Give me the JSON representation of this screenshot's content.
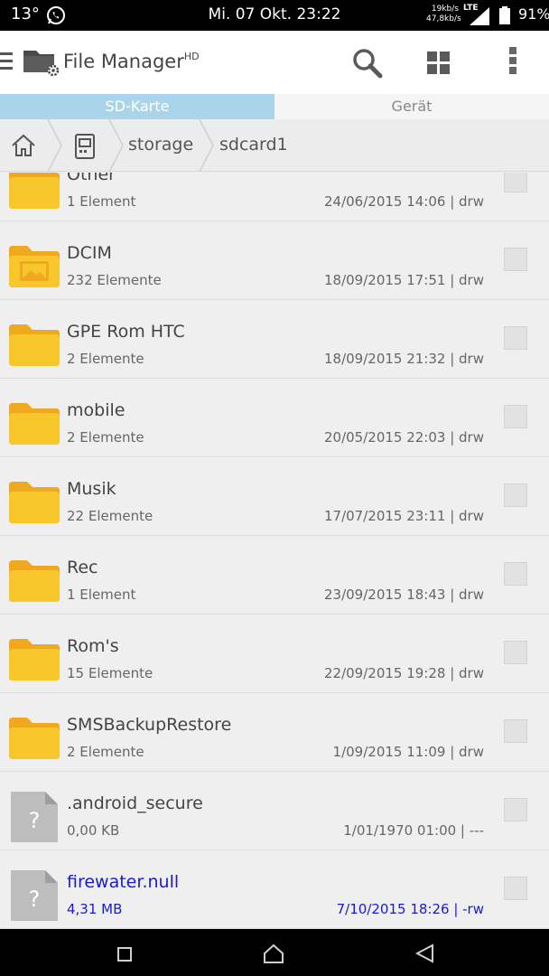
{
  "status_bar": {
    "temperature": "13°",
    "clock": "Mi. 07 Okt. 23:22",
    "speed_up": "19kb/s",
    "speed_down": "47,8kb/s",
    "network": "LTE",
    "battery": "91%"
  },
  "app_bar": {
    "title": "File Manager",
    "title_suffix": "HD"
  },
  "tabs": [
    {
      "label": "SD-Karte",
      "active": true
    },
    {
      "label": "Gerät",
      "active": false
    }
  ],
  "breadcrumb": [
    "storage",
    "sdcard1"
  ],
  "files": [
    {
      "name": "Other",
      "count": "1 Element",
      "meta": "24/06/2015 14:06 | drw",
      "type": "folder"
    },
    {
      "name": "DCIM",
      "count": "232 Elemente",
      "meta": "18/09/2015 17:51 | drw",
      "type": "folder-image"
    },
    {
      "name": "GPE Rom HTC",
      "count": "2 Elemente",
      "meta": "18/09/2015 21:32 | drw",
      "type": "folder"
    },
    {
      "name": "mobile",
      "count": "2 Elemente",
      "meta": "20/05/2015 22:03 | drw",
      "type": "folder"
    },
    {
      "name": "Musik",
      "count": "22 Elemente",
      "meta": "17/07/2015 23:11 | drw",
      "type": "folder"
    },
    {
      "name": "Rec",
      "count": "1 Element",
      "meta": "23/09/2015 18:43 | drw",
      "type": "folder"
    },
    {
      "name": "Rom's",
      "count": "15 Elemente",
      "meta": "22/09/2015 19:28 | drw",
      "type": "folder"
    },
    {
      "name": "SMSBackupRestore",
      "count": "2 Elemente",
      "meta": "1/09/2015 11:09 | drw",
      "type": "folder"
    },
    {
      "name": ".android_secure",
      "count": "0,00 KB",
      "meta": "1/01/1970 01:00 | ---",
      "type": "unknown"
    },
    {
      "name": "firewater.null",
      "count": "4,31 MB",
      "meta": "7/10/2015 18:26 | -rw",
      "type": "unknown",
      "highlight": true
    }
  ],
  "colors": {
    "folder": "#f8c72c",
    "folder_tab": "#f0a81f",
    "tab_active": "#a9d4e9",
    "highlight_text": "#1a1ad6"
  }
}
